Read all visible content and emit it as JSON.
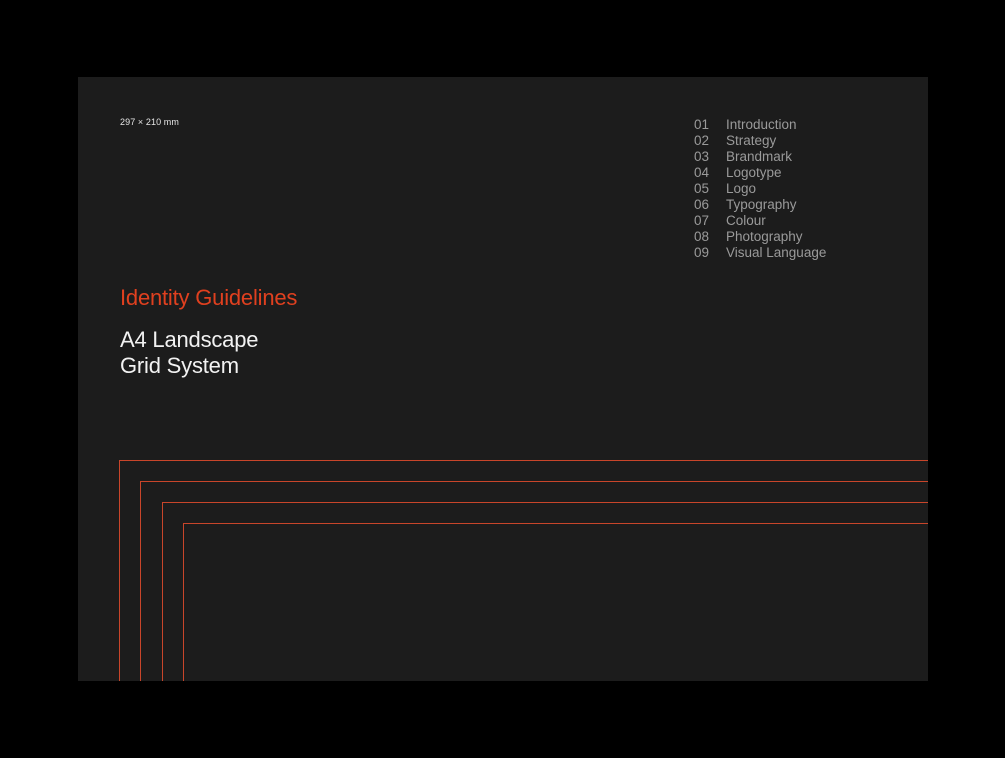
{
  "page": {
    "dimensions": "297 × 210 mm",
    "title": "Identity Guidelines",
    "subtitle_line1": "A4 Landscape",
    "subtitle_line2": "Grid System"
  },
  "toc": [
    {
      "num": "01",
      "label": "Introduction"
    },
    {
      "num": "02",
      "label": "Strategy"
    },
    {
      "num": "03",
      "label": "Brandmark"
    },
    {
      "num": "04",
      "label": "Logotype"
    },
    {
      "num": "05",
      "label": "Logo"
    },
    {
      "num": "06",
      "label": "Typography"
    },
    {
      "num": "07",
      "label": "Colour"
    },
    {
      "num": "08",
      "label": "Photography"
    },
    {
      "num": "09",
      "label": "Visual Language"
    }
  ],
  "colors": {
    "background": "#000000",
    "page": "#1c1c1c",
    "accent": "#e0401f",
    "frame_lines": "#c8452a",
    "toc_text": "#9a9a9a",
    "primary_text": "#f2f2f2"
  }
}
